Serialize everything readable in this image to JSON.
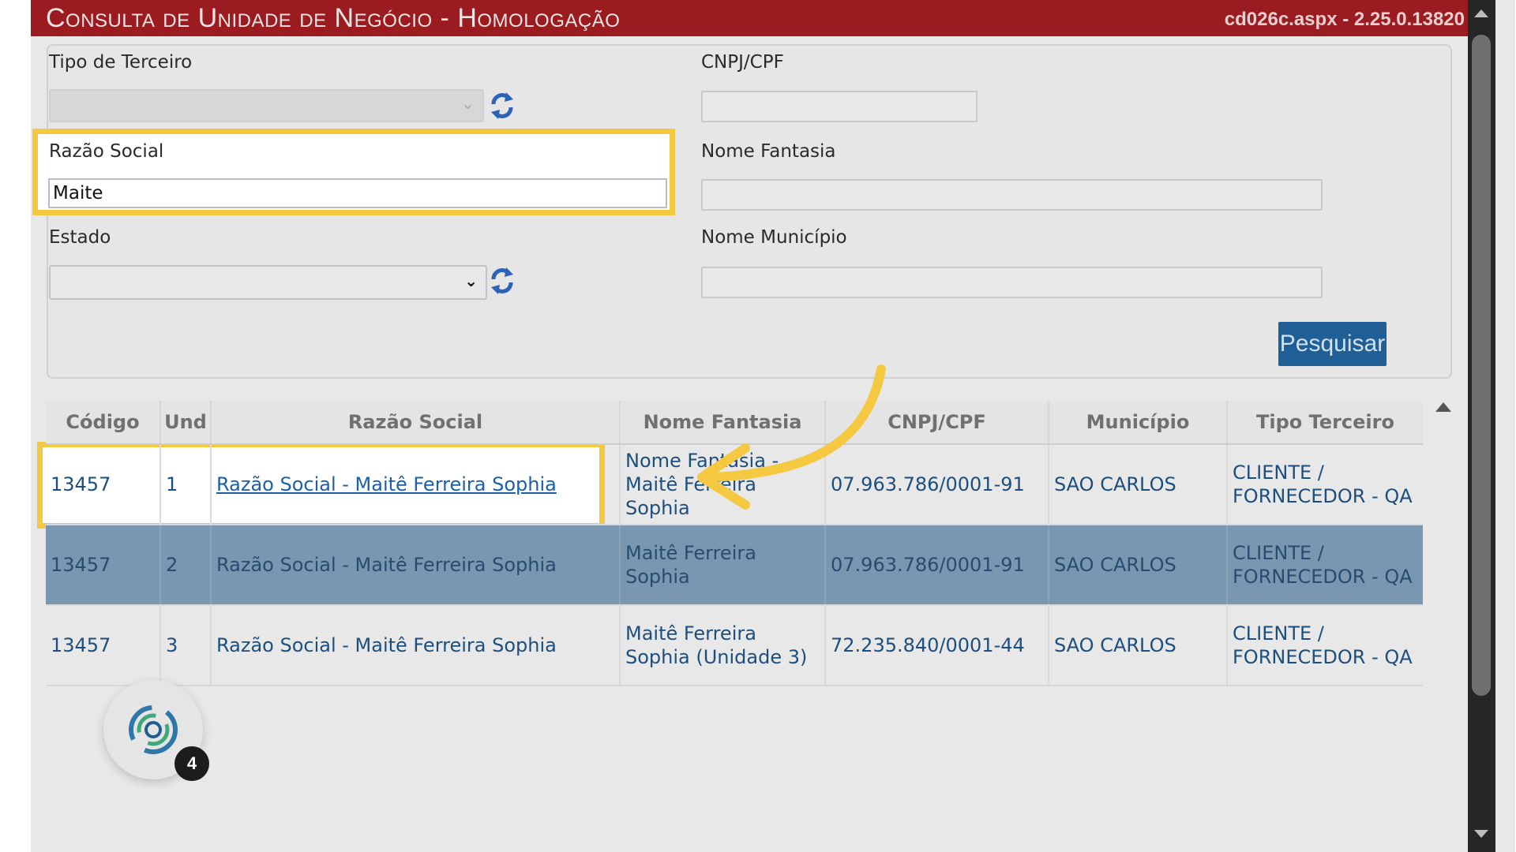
{
  "window": {
    "title": "Consulta de Unidade de Negócio  - Homologação",
    "version": "cd026c.aspx - 2.25.0.13820"
  },
  "filters": {
    "tipo_terceiro_label": "Tipo de Terceiro",
    "cnpj_label": "CNPJ/CPF",
    "razao_label": "Razão Social",
    "razao_value": "Maite",
    "nome_fantasia_label": "Nome Fantasia",
    "estado_label": "Estado",
    "municipio_label": "Nome Município",
    "search_button": "Pesquisar"
  },
  "table": {
    "headers": [
      "Código",
      "Und",
      "Razão Social",
      "Nome Fantasia",
      "CNPJ/CPF",
      "Município",
      "Tipo Terceiro"
    ],
    "rows": [
      {
        "codigo": "13457",
        "und": "1",
        "razao": "Razão Social - Maitê Ferreira Sophia",
        "fantasia": "Nome Fantasia - Maitê Ferreira Sophia",
        "cnpj": "07.963.786/0001-91",
        "municipio": "SAO CARLOS",
        "tipo": "CLIENTE / FORNECEDOR - QA"
      },
      {
        "codigo": "13457",
        "und": "2",
        "razao": "Razão Social - Maitê Ferreira Sophia",
        "fantasia": "Maitê Ferreira Sophia",
        "cnpj": "07.963.786/0001-91",
        "municipio": "SAO CARLOS",
        "tipo": "CLIENTE / FORNECEDOR - QA"
      },
      {
        "codigo": "13457",
        "und": "3",
        "razao": "Razão Social - Maitê Ferreira Sophia",
        "fantasia": "Maitê Ferreira Sophia (Unidade 3)",
        "cnpj": "72.235.840/0001-44",
        "municipio": "SAO CARLOS",
        "tipo": "CLIENTE / FORNECEDOR - QA"
      }
    ]
  },
  "widget": {
    "badge_count": "4"
  },
  "colors": {
    "titlebar": "#9b1c20",
    "highlight": "#f5c842",
    "selected_row": "#7a97b1",
    "button": "#1f5f95"
  },
  "icons": [
    "refresh-icon",
    "chevron-down-icon",
    "arrow-annotation-icon",
    "chat-widget-icon"
  ]
}
